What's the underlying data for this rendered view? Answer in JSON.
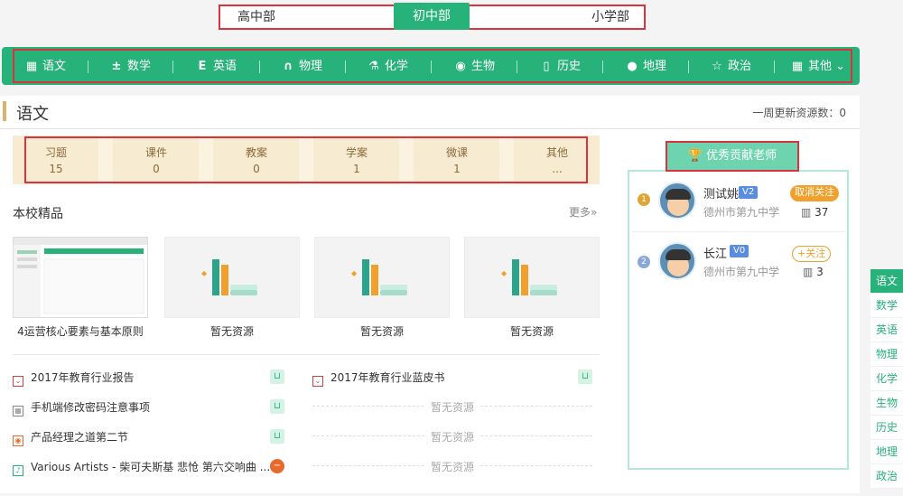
{
  "level_tabs": [
    {
      "label": "高中部",
      "active": false
    },
    {
      "label": "初中部",
      "active": true
    },
    {
      "label": "小学部",
      "active": false
    }
  ],
  "subjects": [
    {
      "label": "语文",
      "icon": "book-icon"
    },
    {
      "label": "数学",
      "icon": "math-icon"
    },
    {
      "label": "英语",
      "icon": "english-icon"
    },
    {
      "label": "物理",
      "icon": "magnet-icon"
    },
    {
      "label": "化学",
      "icon": "flask-icon"
    },
    {
      "label": "生物",
      "icon": "dna-icon"
    },
    {
      "label": "历史",
      "icon": "scroll-icon"
    },
    {
      "label": "地理",
      "icon": "globe-icon"
    },
    {
      "label": "政治",
      "icon": "star-icon"
    },
    {
      "label": "其他",
      "icon": "grid-icon"
    }
  ],
  "panel": {
    "title": "语文",
    "weekly_label": "一周更新资源数：",
    "weekly_count": "0"
  },
  "stats": [
    {
      "label": "习题",
      "value": "15"
    },
    {
      "label": "课件",
      "value": "0"
    },
    {
      "label": "教案",
      "value": "0"
    },
    {
      "label": "学案",
      "value": "1"
    },
    {
      "label": "微课",
      "value": "1"
    },
    {
      "label": "其他",
      "value": "..."
    }
  ],
  "featured": {
    "title": "本校精品",
    "more": "更多»",
    "items": [
      {
        "caption": "4运营核心要素与基本原则"
      },
      {
        "caption": "暂无资源"
      },
      {
        "caption": "暂无资源"
      },
      {
        "caption": "暂无资源"
      }
    ]
  },
  "list_left": [
    {
      "title": "2017年教育行业报告"
    },
    {
      "title": "手机端修改密码注意事项"
    },
    {
      "title": "产品经理之道第二节"
    },
    {
      "title": "Various Artists - 柴可夫斯基 悲怆 第六交响曲 ..."
    }
  ],
  "list_right": [
    {
      "title": "2017年教育行业蓝皮书"
    },
    {
      "title": "暂无资源"
    },
    {
      "title": "暂无资源"
    },
    {
      "title": "暂无资源"
    }
  ],
  "contributors": {
    "title": "优秀贡献老师",
    "teachers": [
      {
        "rank": "1",
        "name": "测试姚",
        "level": "V2",
        "school": "德州市第九中学",
        "action": "取消关注",
        "count": "37"
      },
      {
        "rank": "2",
        "name": "长江",
        "level": "V0",
        "school": "德州市第九中学",
        "action": "+关注",
        "count": "3"
      }
    ]
  },
  "side_nav": [
    "语文",
    "数学",
    "英语",
    "物理",
    "化学",
    "生物",
    "历史",
    "地理",
    "政治"
  ],
  "colors": {
    "accent": "#27b27a",
    "highlight": "#d9333f",
    "stats_bg": "#fbf3df"
  }
}
